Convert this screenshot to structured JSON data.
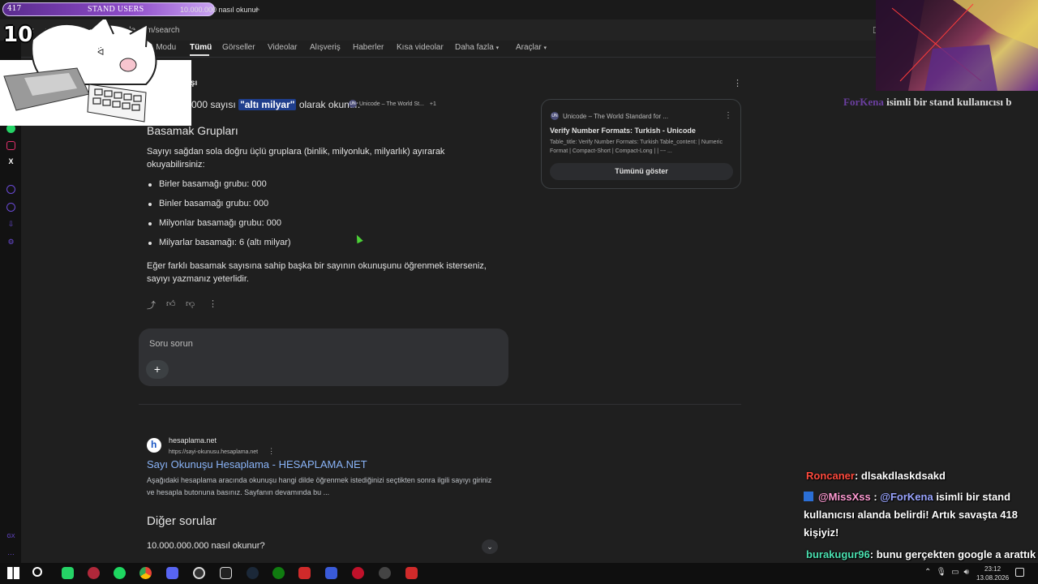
{
  "overlay": {
    "stand_count": "417",
    "stand_title": "STAND USERS",
    "stand_number": "10.000.000",
    "streak": "10",
    "banner_name": "ForKena",
    "banner_text": "isimli bir stand kullanıcısı b"
  },
  "browser": {
    "tab_text": "10.000.000 nasıl okunur",
    "new_tab": "+",
    "url": "google.com/search"
  },
  "search_tabs": {
    "ai_mode": "AI Modu",
    "all": "Tümü",
    "images": "Görseller",
    "videos": "Videolar",
    "shopping": "Alışveriş",
    "news": "Haberler",
    "short_videos": "Kısa videolar",
    "more": "Daha fazla",
    "tools": "Araçlar"
  },
  "ai_overview": {
    "label": "AI Bakışı",
    "answer_prefix": "0.000 sayısı",
    "answer_highlight": "\"altı milyar\"",
    "answer_suffix": "olarak okunur.",
    "chip_badge": "UN",
    "chip_text": "Unicode – The World St...",
    "chip_extra": "+1",
    "heading": "Basamak Grupları",
    "intro": "Sayıyı sağdan sola doğru üçlü gruplara (binlik, milyonluk, milyarlık) ayırarak okuyabilirsiniz:",
    "bullets": [
      "Birler basamağı grubu: 000",
      "Binler basamağı grubu: 000",
      "Milyonlar basamağı grubu: 000",
      "Milyarlar basamağı: 6 (altı milyar)"
    ],
    "outro": "Eğer farklı basamak sayısına sahip başka bir sayının okunuşunu öğrenmek isterseniz, sayıyı yazmanız yeterlidir."
  },
  "source_card": {
    "badge": "UN",
    "site": "Unicode – The World Standard for ...",
    "title": "Verify Number Formats: Turkish - Unicode",
    "snippet": "Table_title: Verify Number Formats: Turkish Table_content: | Numeric Format | Compact-Short | Compact-Long | | --- ...",
    "button": "Tümünü göster"
  },
  "ask": {
    "placeholder": "Soru sorun",
    "plus": "+"
  },
  "result": {
    "site": "hesaplama.net",
    "url": "https://sayi-okunusu.hesaplama.net",
    "title": "Sayı Okunuşu Hesaplama - HESAPLAMA.NET",
    "snippet": "Aşağıdaki hesaplama aracında okunuşu hangi dilde öğrenmek istediğinizi seçtikten sonra ilgili sayıyı giriniz ve hesapla butonuna basınız. Sayfanın devamında bu ..."
  },
  "other_questions": {
    "heading": "Diğer sorular",
    "items": [
      "10.000.000.000 nasıl okunur?"
    ]
  },
  "chat": [
    {
      "user": "Roncaner",
      "text": ": dlsakdlaskdsakd"
    },
    {
      "user": "@MissXss",
      "mention": "@ForKena",
      "text": "isimli bir stand kullanıcısı alanda belirdi! Artık savaşta 418 kişiyiz!"
    },
    {
      "user": "burakugur96",
      "text": ": bunu gerçekten google a arattık"
    }
  ],
  "taskbar": {
    "time": "23:12",
    "date": "13.08.2026"
  }
}
